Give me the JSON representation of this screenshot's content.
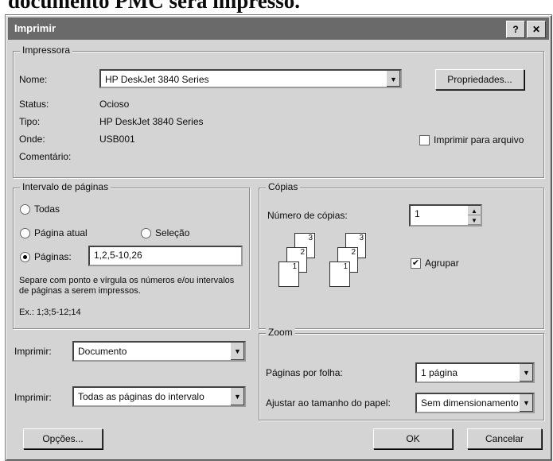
{
  "caption": "documento PMC será impresso.",
  "window": {
    "title": "Imprimir",
    "help_icon": "?",
    "close_icon": "✕"
  },
  "printer": {
    "group_label": "Impressora",
    "name_label": "Nome:",
    "name_value": "HP DeskJet 3840 Series",
    "status_label": "Status:",
    "status_value": "Ocioso",
    "type_label": "Tipo:",
    "type_value": "HP DeskJet 3840 Series",
    "where_label": "Onde:",
    "where_value": "USB001",
    "comment_label": "Comentário:",
    "comment_value": "",
    "properties_button": "Propriedades...",
    "print_to_file_label": "Imprimir para arquivo",
    "print_to_file_checked": false
  },
  "range": {
    "group_label": "Intervalo de páginas",
    "all_label": "Todas",
    "current_label": "Página atual",
    "selection_label": "Seleção",
    "pages_label": "Páginas:",
    "pages_value": "1,2,5-10,26",
    "selected": "pages",
    "help_text": "Separe com ponto e vírgula os números e/ou intervalos de páginas a serem impressos.",
    "example_text": "Ex.: 1;3;5-12;14"
  },
  "copies": {
    "group_label": "Cópias",
    "number_label": "Número de cópias:",
    "number_value": "1",
    "collate_label": "Agrupar",
    "collate_checked": true,
    "page_digits": [
      "1",
      "2",
      "3"
    ]
  },
  "print_what": {
    "label": "Imprimir:",
    "value": "Documento"
  },
  "print_pages": {
    "label": "Imprimir:",
    "value": "Todas as páginas do intervalo"
  },
  "zoom": {
    "group_label": "Zoom",
    "pages_per_sheet_label": "Páginas por folha:",
    "pages_per_sheet_value": "1 página",
    "scale_label": "Ajustar ao tamanho do papel:",
    "scale_value": "Sem dimensionamento"
  },
  "buttons": {
    "options": "Opções...",
    "ok": "OK",
    "cancel": "Cancelar"
  }
}
